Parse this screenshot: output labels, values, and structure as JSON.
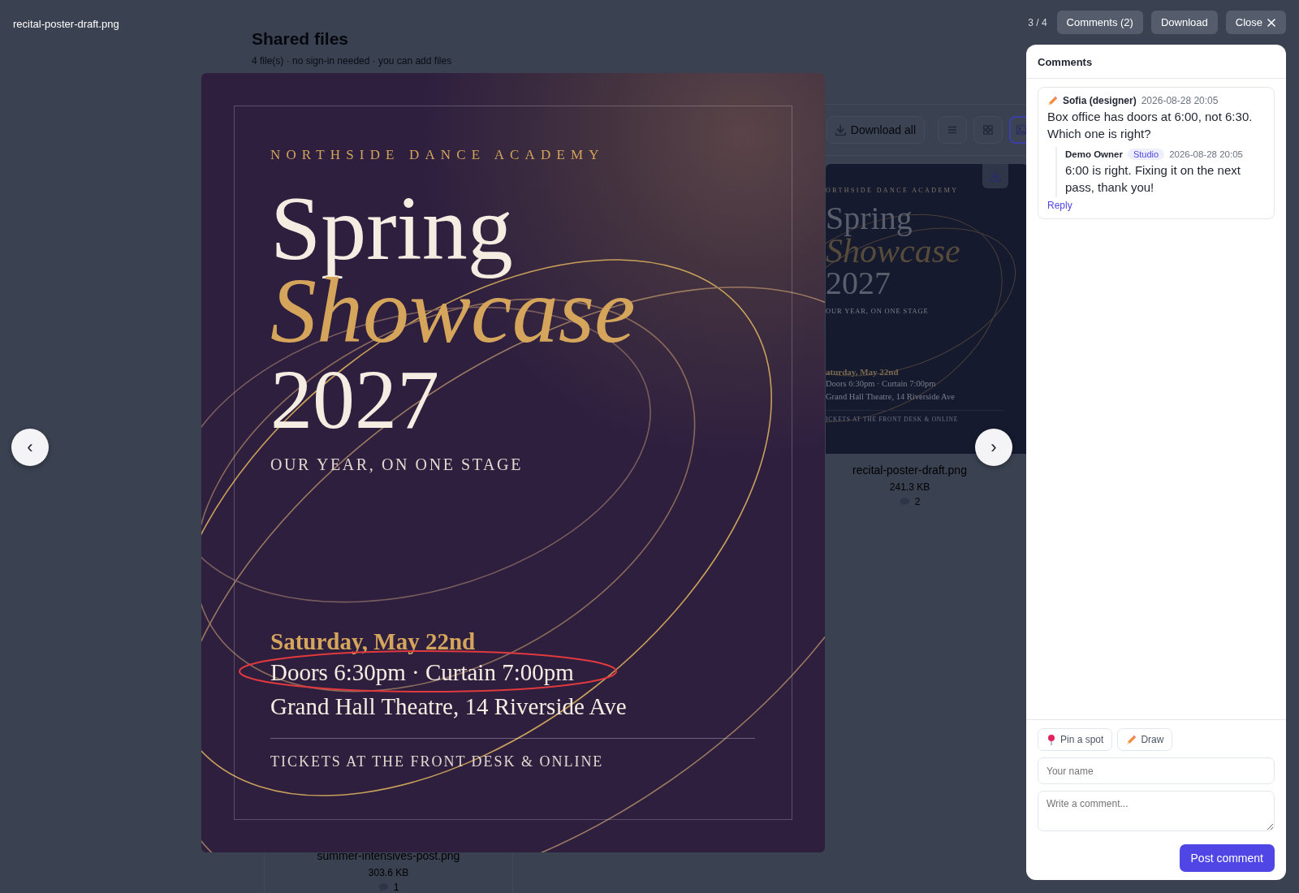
{
  "background_page": {
    "title": "Shared files",
    "subtitle": "4 file(s) · no sign-in needed · you can add files",
    "download_all": "Download all",
    "views": [
      {
        "kind": "list",
        "selected": false
      },
      {
        "kind": "grid",
        "selected": false
      },
      {
        "kind": "gallery",
        "selected": true
      }
    ],
    "files": [
      {
        "name": "recital-poster-draft.png",
        "size": "241.3 KB",
        "comments": "2",
        "preview": {
          "lines": [
            {
              "kind": "eyebrow",
              "text": "ORTHSIDE DANCE ACADEMY"
            },
            {
              "kind": "title",
              "text": "Spring"
            },
            {
              "kind": "title-accent",
              "text": "Showcase"
            },
            {
              "kind": "year",
              "text": "2027"
            },
            {
              "kind": "tagline",
              "text": "OUR YEAR, ON ONE STAGE"
            },
            {
              "kind": "date",
              "text": "aturday, May 22nd"
            },
            {
              "kind": "detail",
              "text": "Doors 6:30pm · Curtain 7:00pm"
            },
            {
              "kind": "detail",
              "text": "Grand Hall Theatre, 14 Riverside Ave"
            },
            {
              "kind": "footer",
              "text": "ICKETS AT THE FRONT DESK & ONLINE"
            }
          ]
        }
      },
      {
        "name": "summer-intensives-post.png",
        "size": "303.6 KB",
        "comments": "1"
      }
    ]
  },
  "topbar": {
    "filename": "recital-poster-draft.png",
    "position": "3 / 4",
    "buttons": [
      {
        "label": "Comments (2)",
        "kind": "text"
      },
      {
        "label": "Download",
        "kind": "text"
      },
      {
        "label": "Close",
        "kind": "close"
      }
    ]
  },
  "nav": {
    "previous": "‹",
    "next": "›"
  },
  "poster": {
    "lines": [
      {
        "kind": "eyebrow",
        "text": "NORTHSIDE DANCE ACADEMY",
        "circled": false
      },
      {
        "kind": "title",
        "text": "Spring",
        "circled": false
      },
      {
        "kind": "title-accent",
        "text": "Showcase",
        "circled": false
      },
      {
        "kind": "year",
        "text": "2027",
        "circled": false
      },
      {
        "kind": "tagline",
        "text": "OUR YEAR, ON ONE STAGE",
        "circled": false
      },
      {
        "kind": "date",
        "text": "Saturday, May 22nd",
        "circled": false
      },
      {
        "kind": "detail",
        "text": "Doors 6:30pm · Curtain 7:00pm",
        "circled": true
      },
      {
        "kind": "detail",
        "text": "Grand Hall Theatre, 14 Riverside Ave",
        "circled": false
      },
      {
        "kind": "footer",
        "text": "TICKETS AT THE FRONT DESK & ONLINE",
        "circled": false
      }
    ]
  },
  "comments_panel": {
    "title": "Comments",
    "threads": [
      {
        "kind": "drawing",
        "author": "Sofia (designer)",
        "time": "2026-08-28 20:05",
        "text": "Box office has doors at 6:00, not 6:30. Which one is right?",
        "replies": [
          {
            "author": "Demo Owner",
            "badge": "Studio",
            "time": "2026-08-28 20:05",
            "text": "6:00 is right. Fixing it on the next pass, thank you!"
          }
        ],
        "reply_link": "Reply"
      }
    ],
    "tools": [
      {
        "kind": "pin",
        "label": "Pin a spot"
      },
      {
        "kind": "draw",
        "label": "Draw"
      }
    ],
    "name_placeholder": "Your name",
    "comment_placeholder": "Write a comment...",
    "submit": "Post comment"
  }
}
